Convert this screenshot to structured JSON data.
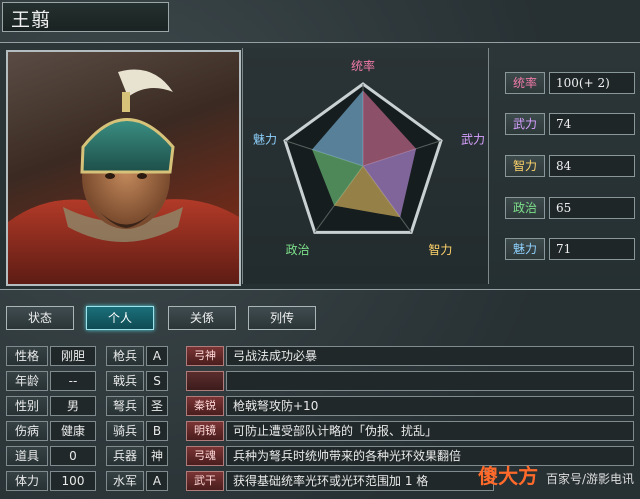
{
  "general": {
    "name": "王翦"
  },
  "radar": {
    "labels": {
      "leadership": "统率",
      "force": "武力",
      "intelligence": "智力",
      "politics": "政治",
      "charm": "魅力"
    },
    "values": {
      "leadership": 100,
      "force": 74,
      "intelligence": 84,
      "politics": 65,
      "charm": 71
    },
    "max": 100
  },
  "stats": [
    {
      "label": "统率",
      "value": "100(+ 2)",
      "color": "#f07aa8"
    },
    {
      "label": "武力",
      "value": "74",
      "color": "#d7a0ff"
    },
    {
      "label": "智力",
      "value": "84",
      "color": "#ffd46a"
    },
    {
      "label": "政治",
      "value": "65",
      "color": "#7de08a"
    },
    {
      "label": "魅力",
      "value": "71",
      "color": "#8fd2ff"
    }
  ],
  "tabs": [
    "状态",
    "个人",
    "关係",
    "列传"
  ],
  "active_tab": "个人",
  "attributes": [
    {
      "label": "性格",
      "value": "刚胆"
    },
    {
      "label": "年龄",
      "value": "--"
    },
    {
      "label": "性别",
      "value": "男"
    },
    {
      "label": "伤病",
      "value": "健康"
    },
    {
      "label": "道具",
      "value": "0"
    },
    {
      "label": "体力",
      "value": "100"
    }
  ],
  "troops": [
    {
      "label": "枪兵",
      "grade": "A"
    },
    {
      "label": "戟兵",
      "grade": "S"
    },
    {
      "label": "弩兵",
      "grade": "圣"
    },
    {
      "label": "骑兵",
      "grade": "B"
    },
    {
      "label": "兵器",
      "grade": "神"
    },
    {
      "label": "水军",
      "grade": "A"
    }
  ],
  "skills": [
    {
      "name": "弓神",
      "desc": "弓战法成功必暴"
    },
    {
      "name": "",
      "desc": ""
    },
    {
      "name": "秦锐",
      "desc": "枪戟弩攻防+10"
    },
    {
      "name": "明镜",
      "desc": "可防止遭受部队计略的「伪报、扰乱」"
    },
    {
      "name": "弓魂",
      "desc": "兵种为弩兵时统帅带来的各种光环效果翻倍"
    },
    {
      "name": "武干",
      "desc": "获得基础统率光环或光环范围加 1 格"
    }
  ],
  "watermark": {
    "logo": "傻大方",
    "text": "百家号/游影电讯"
  }
}
